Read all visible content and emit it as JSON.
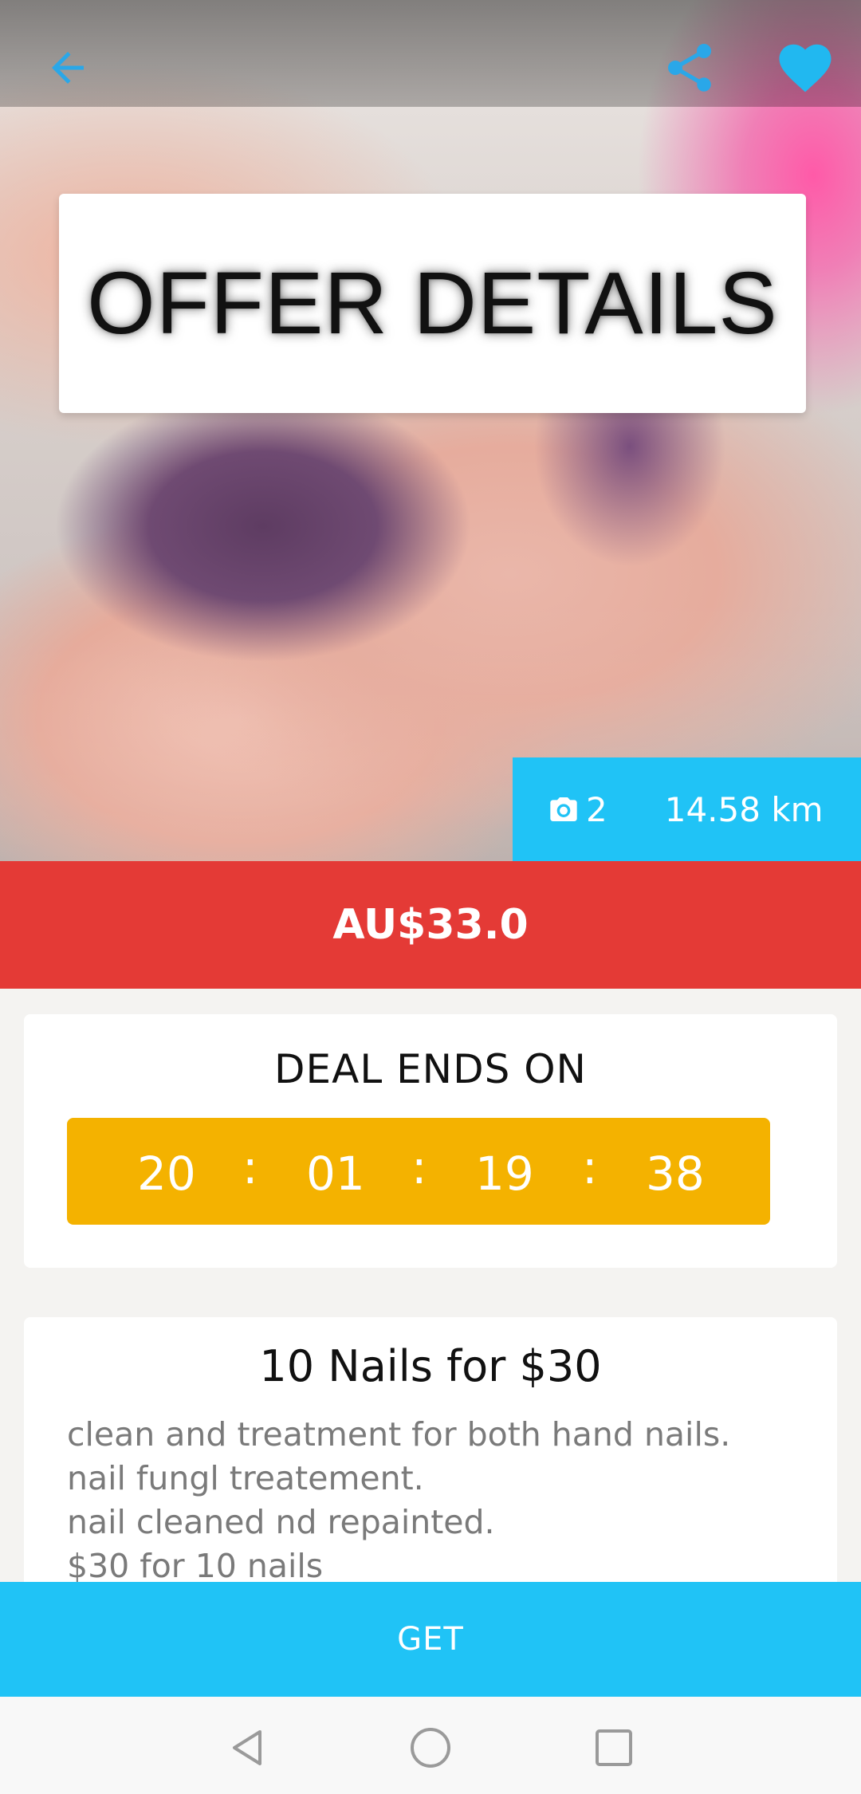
{
  "header": {
    "back_icon": "arrow-left-icon",
    "share_icon": "share-icon",
    "favorite_icon": "heart-icon",
    "accent_color": "#2aa7e8"
  },
  "hero": {
    "title": "OFFER DETAILS",
    "photo_icon": "camera-icon",
    "photo_count": "2",
    "distance": "14.58 km",
    "info_bar_color": "#20c3f6"
  },
  "price": {
    "label": "AU$33.0",
    "color": "#e43a36"
  },
  "deal": {
    "title": "DEAL ENDS ON",
    "countdown": {
      "days": "20",
      "hours": "01",
      "minutes": "19",
      "seconds": "38",
      "separator": ":",
      "color": "#f4b200"
    }
  },
  "offer": {
    "title": "10 Nails for $30",
    "lines": [
      "clean and treatment for both hand nails.",
      "nail fungl treatement.",
      "nail cleaned nd repainted.",
      "$30 for 10 nails"
    ]
  },
  "action": {
    "get_label": "GET",
    "color": "#20c3f6"
  },
  "navbar": {
    "back_icon": "triangle-back-icon",
    "home_icon": "circle-home-icon",
    "recents_icon": "square-recents-icon"
  }
}
